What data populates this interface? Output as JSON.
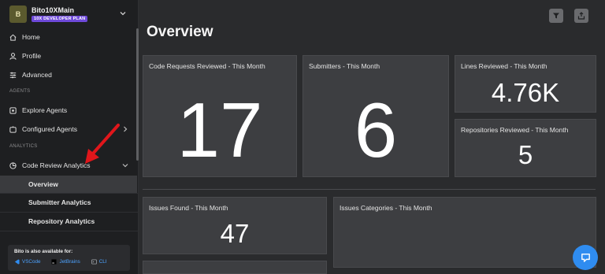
{
  "workspace": {
    "avatar_initial": "B",
    "name": "Bito10XMain",
    "plan": "10X DEVELOPER PLAN"
  },
  "sidebar": {
    "items": [
      {
        "label": "Home",
        "icon": "home-icon"
      },
      {
        "label": "Profile",
        "icon": "user-icon"
      },
      {
        "label": "Advanced",
        "icon": "sliders-icon"
      }
    ],
    "section_agents": "AGENTS",
    "agents": [
      {
        "label": "Explore Agents",
        "icon": "explore-icon"
      },
      {
        "label": "Configured Agents",
        "icon": "agents-icon"
      }
    ],
    "section_analytics": "ANALYTICS",
    "analytics_group": {
      "label": "Code Review Analytics",
      "icon": "analytics-icon"
    },
    "analytics_sub": [
      {
        "label": "Overview",
        "active": true
      },
      {
        "label": "Submitter Analytics",
        "active": false
      },
      {
        "label": "Repository Analytics",
        "active": false
      }
    ],
    "promo": {
      "title": "Bito is also available for:",
      "links": [
        {
          "label": "VSCode",
          "icon": "vscode-icon"
        },
        {
          "label": "JetBrains",
          "icon": "jetbrains-icon"
        },
        {
          "label": "CLI",
          "icon": "cli-icon"
        }
      ]
    }
  },
  "main": {
    "title": "Overview",
    "actions": [
      {
        "name": "filter-icon"
      },
      {
        "name": "export-icon"
      }
    ],
    "cards": {
      "code_requests": {
        "label": "Code Requests Reviewed - This Month",
        "value": "17"
      },
      "submitters": {
        "label": "Submitters - This Month",
        "value": "6"
      },
      "lines": {
        "label": "Lines Reviewed - This Month",
        "value": "4.76K"
      },
      "repositories": {
        "label": "Repositories Reviewed - This Month",
        "value": "5"
      },
      "issues": {
        "label": "Issues Found - This Month",
        "value": "47"
      },
      "categories": {
        "label": "Issues Categories - This Month"
      }
    }
  },
  "colors": {
    "accent_plan": "#6e49d9",
    "chat": "#2f8cf0",
    "link": "#4da3ff",
    "arrow": "#e0161b"
  }
}
